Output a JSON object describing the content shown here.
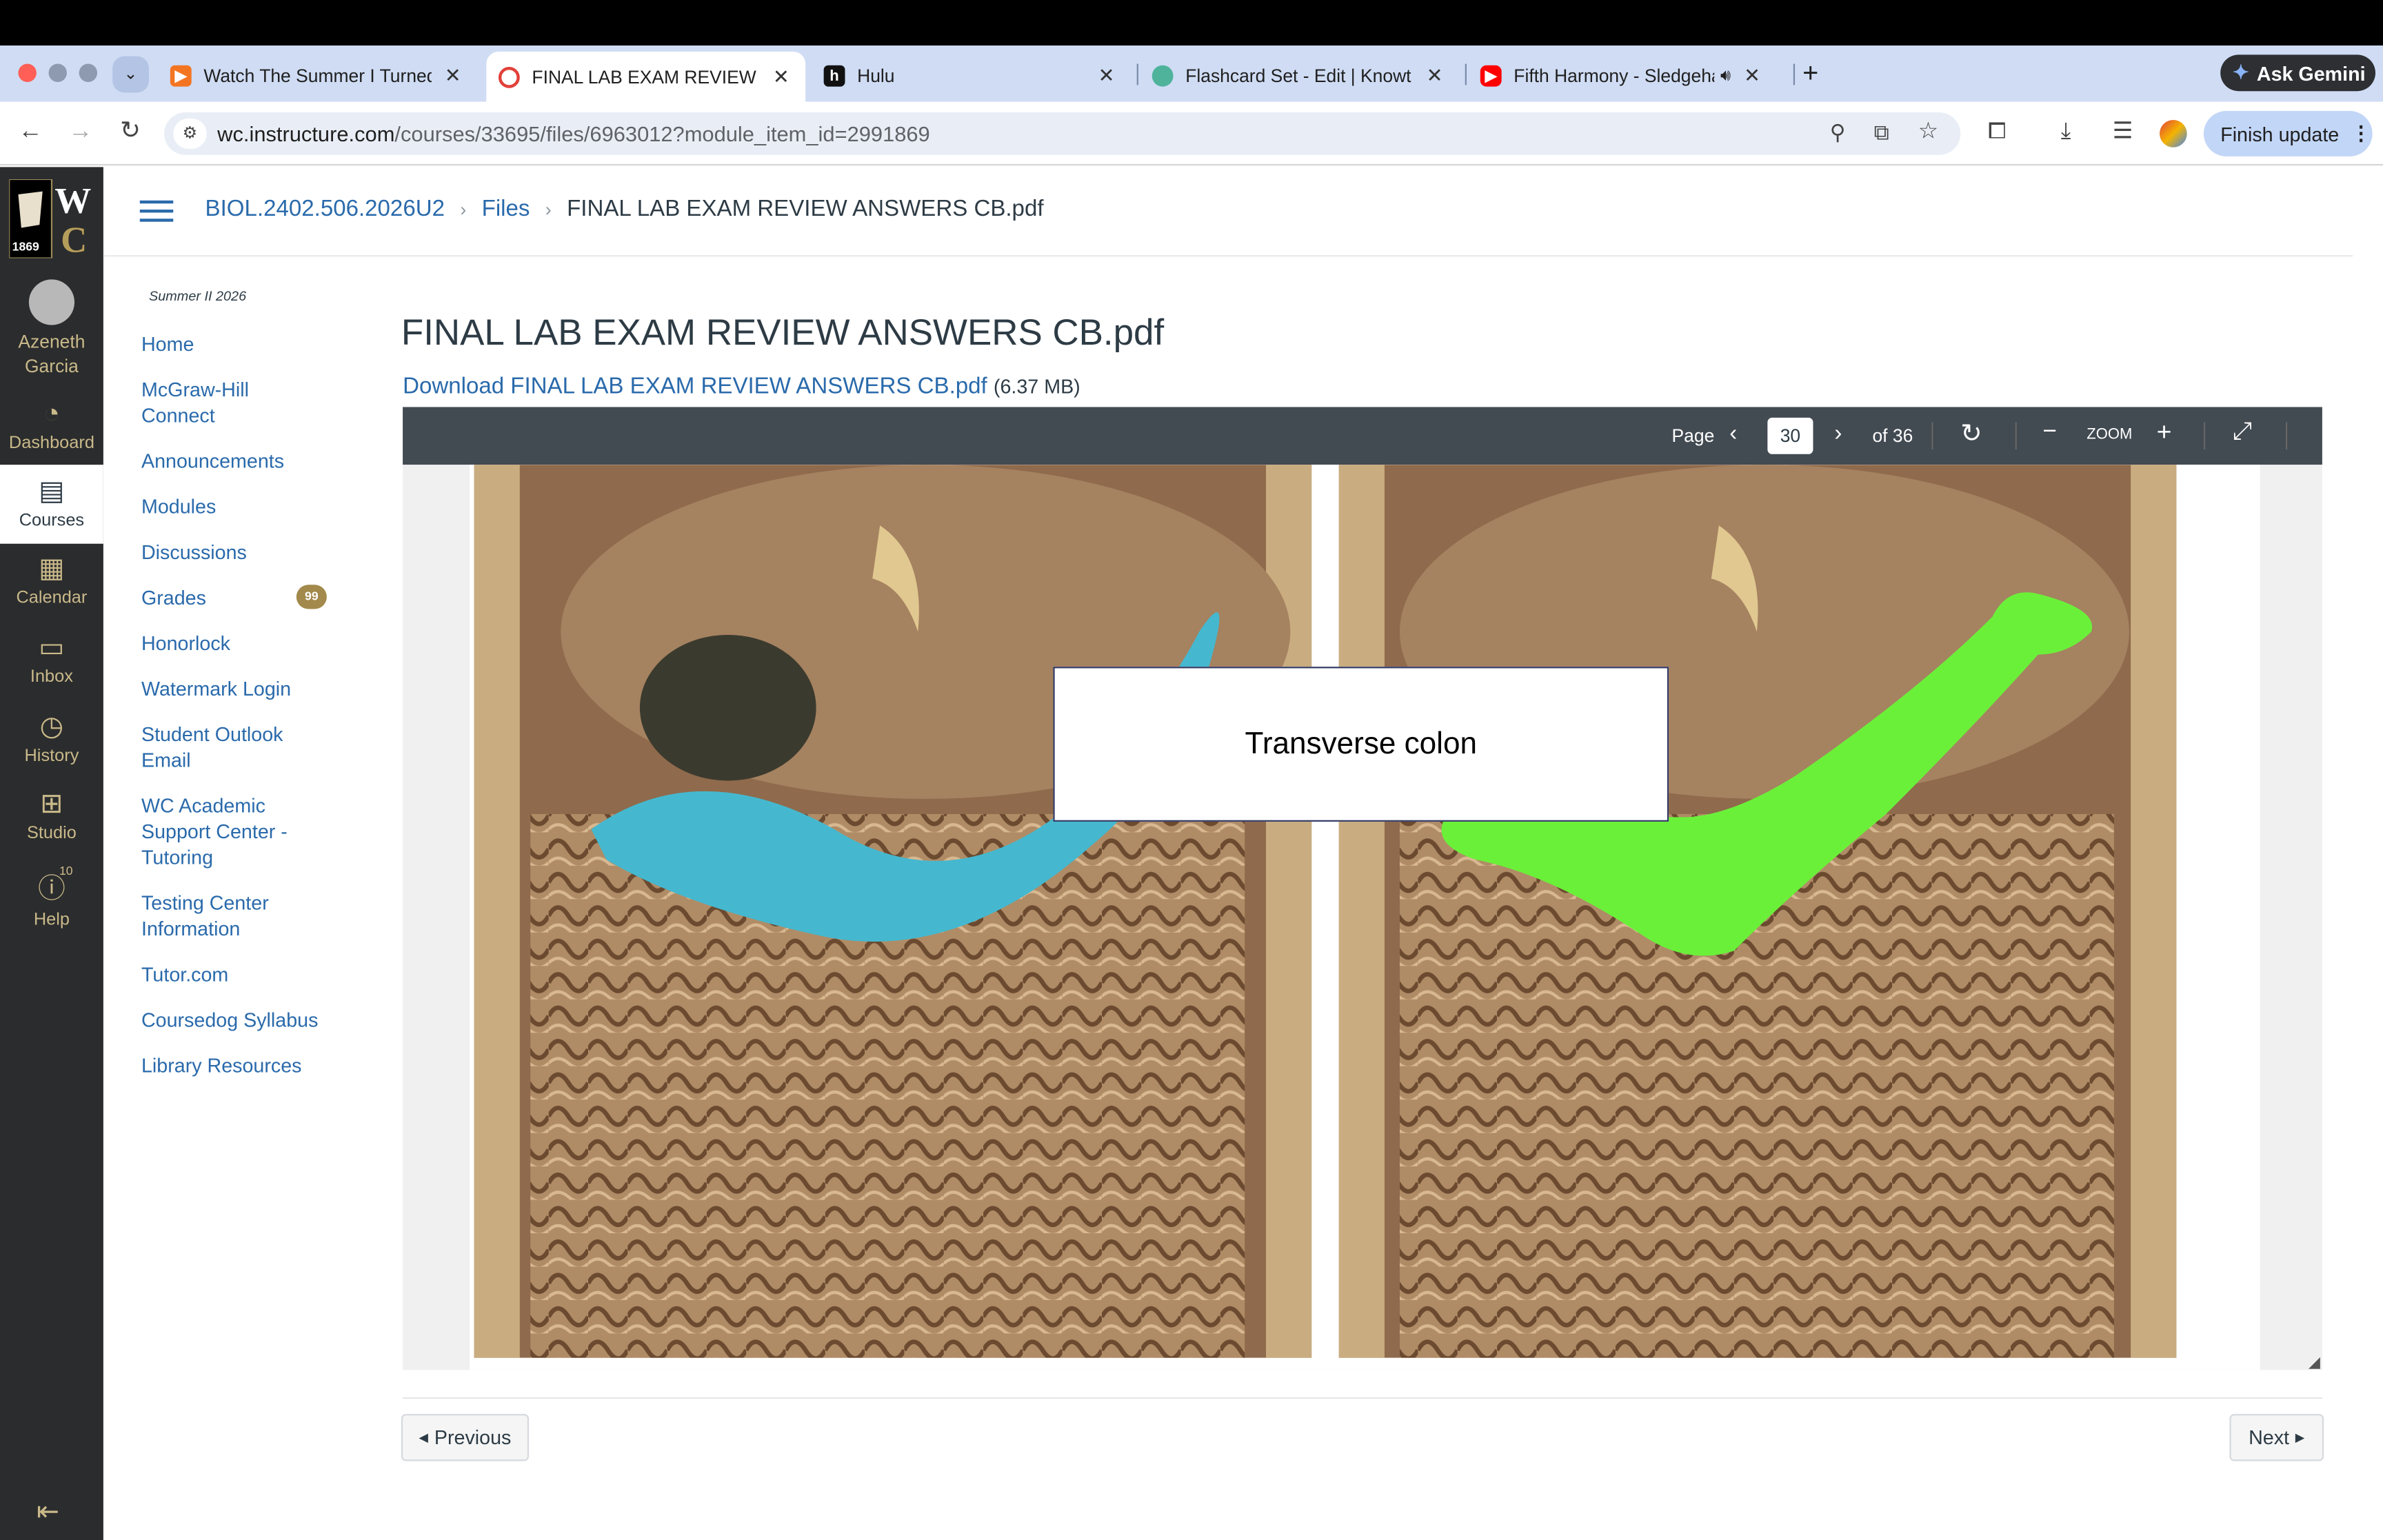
{
  "browser": {
    "tabs": [
      {
        "title": "Watch The Summer I Turned Pretty",
        "icon": "crunchyroll-icon"
      },
      {
        "title": "FINAL LAB EXAM REVIEW ANSWERS",
        "icon": "canvas-icon"
      },
      {
        "title": "Hulu",
        "icon": "hulu-icon"
      },
      {
        "title": "Flashcard Set - Edit | Knowt",
        "icon": "knowt-icon"
      },
      {
        "title": "Fifth Harmony - Sledgehammer",
        "icon": "youtube-icon"
      }
    ],
    "ask_gemini": "Ask Gemini",
    "url_host": "wc.instructure.com",
    "url_path": "/courses/33695/files/6963012?module_item_id=2991869",
    "finish_update": "Finish update"
  },
  "global_nav": {
    "logo_year": "1869",
    "account_name": "Azeneth Garcia",
    "items": [
      {
        "label": "Dashboard",
        "icon": "dashboard-icon"
      },
      {
        "label": "Courses",
        "icon": "courses-icon"
      },
      {
        "label": "Calendar",
        "icon": "calendar-icon"
      },
      {
        "label": "Inbox",
        "icon": "inbox-icon"
      },
      {
        "label": "History",
        "icon": "history-icon"
      },
      {
        "label": "Studio",
        "icon": "studio-icon"
      },
      {
        "label": "Help",
        "icon": "help-icon"
      }
    ],
    "help_badge": "10"
  },
  "breadcrumb": {
    "course": "BIOL.2402.506.2026U2",
    "section": "Files",
    "file": "FINAL LAB EXAM REVIEW ANSWERS CB.pdf"
  },
  "course_nav": {
    "term": "Summer II 2026",
    "items": [
      {
        "label": "Home"
      },
      {
        "label": "McGraw-Hill Connect"
      },
      {
        "label": "Announcements"
      },
      {
        "label": "Modules"
      },
      {
        "label": "Discussions"
      },
      {
        "label": "Grades",
        "badge": "99"
      },
      {
        "label": "Honorlock"
      },
      {
        "label": "Watermark Login"
      },
      {
        "label": "Student Outlook Email"
      },
      {
        "label": "WC Academic Support Center - Tutoring"
      },
      {
        "label": "Testing Center Information"
      },
      {
        "label": "Tutor.com"
      },
      {
        "label": "Coursedog Syllabus"
      },
      {
        "label": "Library Resources"
      }
    ]
  },
  "file": {
    "title": "FINAL LAB EXAM REVIEW ANSWERS CB.pdf",
    "download_label": "Download FINAL LAB EXAM REVIEW ANSWERS CB.pdf",
    "size": "(6.37 MB)"
  },
  "viewer": {
    "page_label": "Page",
    "page_value": "30",
    "page_total": "of 36",
    "zoom_label": "ZOOM",
    "slide_label": "Transverse colon"
  },
  "footer": {
    "previous": "Previous",
    "next": "Next"
  },
  "colors": {
    "canvas_nav_bg": "#2b2c2d",
    "link": "#2a6aab",
    "highlight_left": "#45b8cf",
    "highlight_right": "#6bf03a"
  }
}
